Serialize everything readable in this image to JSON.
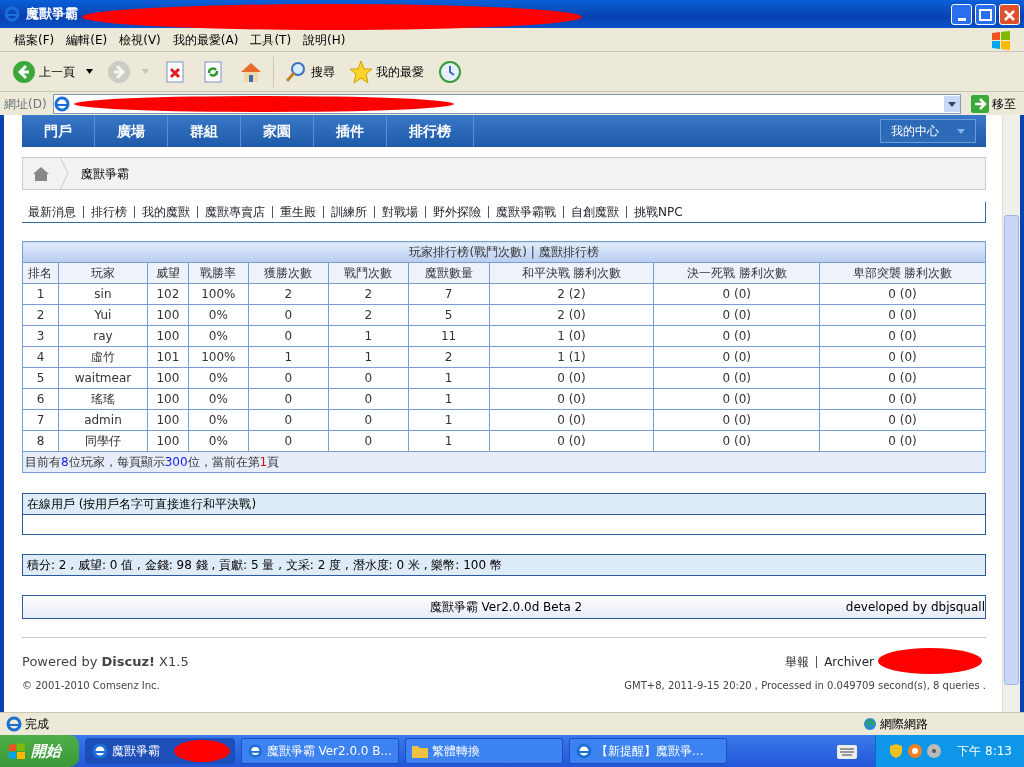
{
  "window": {
    "title": "魔獸爭霸",
    "menu": [
      "檔案(F)",
      "編輯(E)",
      "檢視(V)",
      "我的最愛(A)",
      "工具(T)",
      "說明(H)"
    ],
    "toolbar": [
      {
        "kind": "back",
        "label": "上一頁",
        "disabled": false
      },
      {
        "kind": "forward",
        "disabled": true
      },
      {
        "kind": "stop"
      },
      {
        "kind": "refresh"
      },
      {
        "kind": "home"
      },
      {
        "kind": "search",
        "label": "搜尋"
      },
      {
        "kind": "favorites",
        "label": "我的最愛"
      },
      {
        "kind": "history"
      }
    ],
    "address_label": "網址(D)",
    "go": "移至"
  },
  "nav": {
    "items": [
      "門戶",
      "廣場",
      "群組",
      "家園",
      "插件",
      "排行榜"
    ],
    "user_menu": "我的中心"
  },
  "breadcrumb": "魔獸爭霸",
  "links": [
    "最新消息",
    "排行榜",
    "我的魔獸",
    "魔獸專賣店",
    "重生殿",
    "訓練所",
    "對戰場",
    "野外探險",
    "魔獸爭霸戰",
    "自創魔獸",
    "挑戰NPC"
  ],
  "table": {
    "title": "玩家排行榜(戰鬥次數) | 魔獸排行榜",
    "columns": [
      "排名",
      "玩家",
      "威望",
      "戰勝率",
      "獲勝次數",
      "戰鬥次數",
      "魔獸數量",
      "和平決戰 勝利次數",
      "決一死戰 勝利次數",
      "卑部突襲 勝利次數"
    ],
    "rows": [
      [
        "1",
        "sin",
        "102",
        "100%",
        "2",
        "2",
        "7",
        "2 (2)",
        "0 (0)",
        "0 (0)"
      ],
      [
        "2",
        "Yui",
        "100",
        "0%",
        "0",
        "2",
        "5",
        "2 (0)",
        "0 (0)",
        "0 (0)"
      ],
      [
        "3",
        "ray",
        "100",
        "0%",
        "0",
        "1",
        "11",
        "1 (0)",
        "0 (0)",
        "0 (0)"
      ],
      [
        "4",
        "虛竹",
        "101",
        "100%",
        "1",
        "1",
        "2",
        "1 (1)",
        "0 (0)",
        "0 (0)"
      ],
      [
        "5",
        "waitmear",
        "100",
        "0%",
        "0",
        "0",
        "1",
        "0 (0)",
        "0 (0)",
        "0 (0)"
      ],
      [
        "6",
        "瑤瑤",
        "100",
        "0%",
        "0",
        "0",
        "1",
        "0 (0)",
        "0 (0)",
        "0 (0)"
      ],
      [
        "7",
        "admin",
        "100",
        "0%",
        "0",
        "0",
        "1",
        "0 (0)",
        "0 (0)",
        "0 (0)"
      ],
      [
        "8",
        "同學仔",
        "100",
        "0%",
        "0",
        "0",
        "1",
        "0 (0)",
        "0 (0)",
        "0 (0)"
      ]
    ],
    "footer": [
      {
        "kind": "text",
        "text": "目前有"
      },
      {
        "kind": "count",
        "text": "8"
      },
      {
        "kind": "text",
        "text": "位玩家，每頁顯示"
      },
      {
        "kind": "count",
        "text": "300"
      },
      {
        "kind": "text",
        "text": "位，當前在第"
      },
      {
        "kind": "current",
        "text": "1"
      },
      {
        "kind": "text",
        "text": "頁"
      }
    ]
  },
  "online": {
    "title": "在線用戶 (按用戶名字可直接進行和平決戰)"
  },
  "stats": "積分: 2 , 威望: 0 值 , 金錢: 98 錢 , 貢獻: 5 量 , 文采: 2 度 , 潛水度: 0 米 , 樂幣: 100 幣",
  "version": {
    "name": "魔獸爭霸 Ver2.0.0d Beta 2",
    "developer": "developed by dbjsquall"
  },
  "footer": {
    "powered": "Powered by **Discuz!** X1.5",
    "copyright": "© 2001-2010 Comsenz Inc.",
    "links": [
      "舉報",
      "Archiver"
    ],
    "info": "GMT+8, 2011-9-15 20:20 , Processed in 0.049709 second(s), 8 queries ."
  },
  "status_bar": {
    "text": "完成",
    "zone": "網際網路"
  },
  "taskbar": {
    "start": "開始",
    "tasks": [
      {
        "label": "魔獸爭霸",
        "selected": true
      },
      {
        "label": "魔獸爭霸 Ver2.0.0 B...",
        "selected": false
      },
      {
        "label": "繁體轉換",
        "selected": false,
        "kind": "folder"
      },
      {
        "label": "【新提醒】魔獸爭...",
        "selected": false
      }
    ],
    "clock": "下午 8:13"
  }
}
